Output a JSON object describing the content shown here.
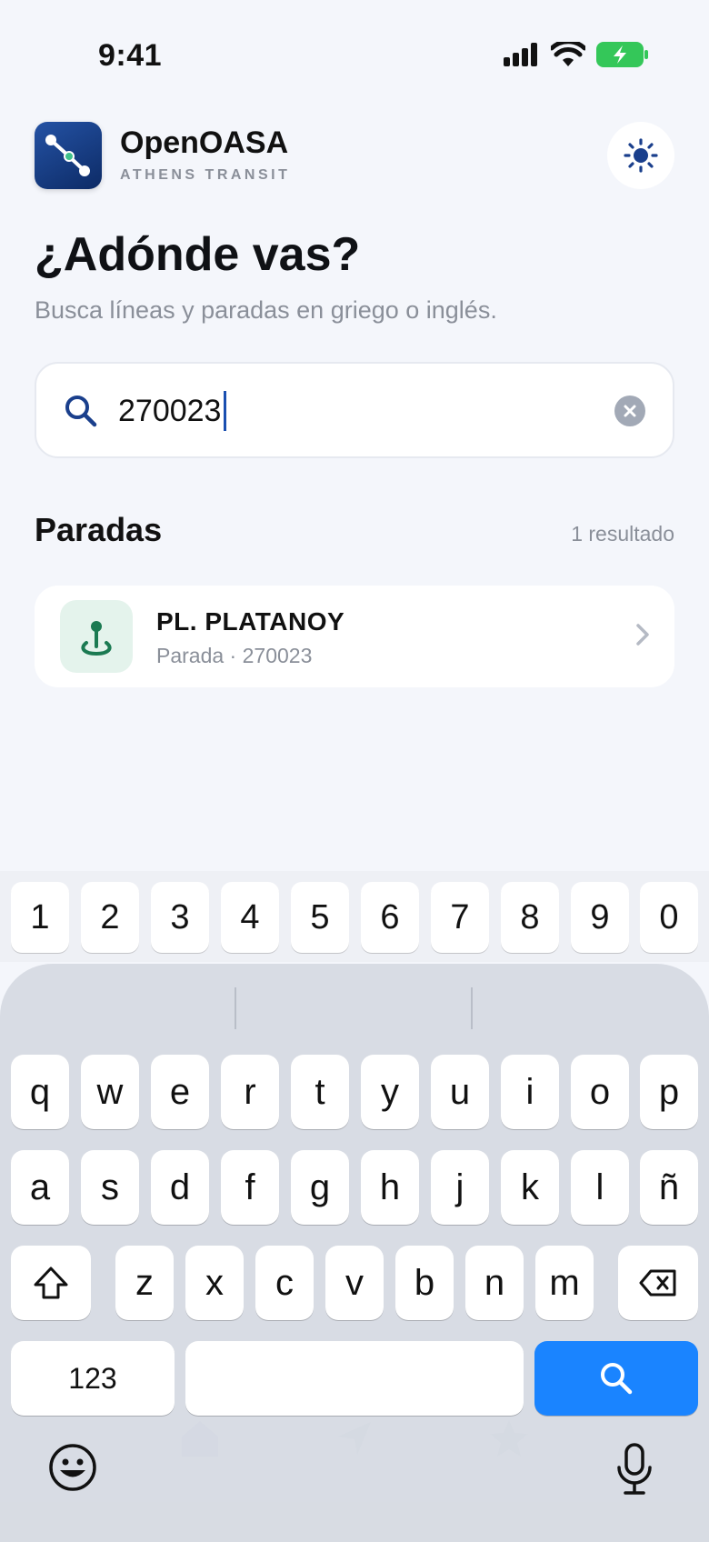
{
  "status_bar": {
    "time": "9:41"
  },
  "app": {
    "name": "OpenOASA",
    "subtitle": "ATHENS TRANSIT",
    "theme_icon": "sun-icon"
  },
  "hero": {
    "title": "¿Adónde vas?",
    "subtitle": "Busca líneas y paradas en griego o inglés."
  },
  "search": {
    "value": "270023",
    "placeholder": ""
  },
  "results": {
    "section_title": "Paradas",
    "count_label": "1 resultado",
    "items": [
      {
        "name": "PL. PLATANOY",
        "meta": "Parada · 270023",
        "icon": "stop-pin-icon"
      }
    ]
  },
  "keyboard": {
    "numbers": [
      "1",
      "2",
      "3",
      "4",
      "5",
      "6",
      "7",
      "8",
      "9",
      "0"
    ],
    "row1": [
      "q",
      "w",
      "e",
      "r",
      "t",
      "y",
      "u",
      "i",
      "o",
      "p"
    ],
    "row2": [
      "a",
      "s",
      "d",
      "f",
      "g",
      "h",
      "j",
      "k",
      "l",
      "ñ"
    ],
    "row3": [
      "z",
      "x",
      "c",
      "v",
      "b",
      "n",
      "m"
    ],
    "numbers_key": "123"
  },
  "colors": {
    "accent": "#1a84ff",
    "brand": "#1a3f8c",
    "stop_green": "#1b7a52",
    "background": "#f4f6fb"
  }
}
